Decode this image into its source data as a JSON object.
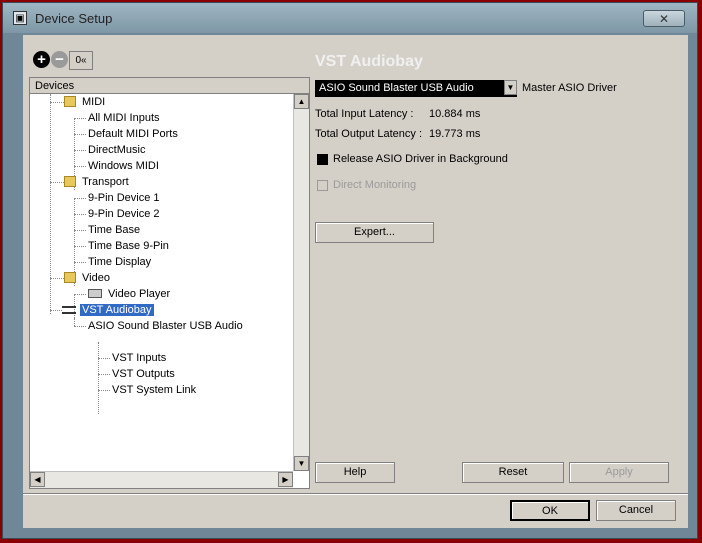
{
  "window": {
    "title": "Device Setup",
    "close_glyph": "✕"
  },
  "toolbar": {
    "reset_label": "0«",
    "add_glyph": "+",
    "remove_glyph": "−"
  },
  "devices_header": "Devices",
  "tree": {
    "midi": "MIDI",
    "midi_items": [
      "All MIDI Inputs",
      "Default MIDI Ports",
      "DirectMusic",
      "Windows MIDI"
    ],
    "transport": "Transport",
    "transport_items": [
      "9-Pin Device 1",
      "9-Pin Device 2",
      "Time Base",
      "Time Base 9-Pin",
      "Time Display"
    ],
    "video": "Video",
    "video_items": [
      "Video Player"
    ],
    "vst_audiobay": "VST Audiobay",
    "asio_driver": "ASIO Sound Blaster USB Audio",
    "asio_items": [
      "VST Inputs",
      "VST Outputs",
      "VST System Link"
    ]
  },
  "panel": {
    "title": "VST Audiobay",
    "driver_value": "ASIO Sound Blaster USB Audio",
    "driver_label": "Master ASIO Driver",
    "input_latency_label": "Total Input Latency :",
    "input_latency_value": "10.884 ms",
    "output_latency_label": "Total Output Latency :",
    "output_latency_value": "19.773 ms",
    "release_label": "Release ASIO Driver in Background",
    "release_checked": true,
    "direct_monitoring_label": "Direct Monitoring",
    "direct_monitoring_enabled": false,
    "expert_button": "Expert..."
  },
  "buttons": {
    "help": "Help",
    "reset": "Reset",
    "apply": "Apply",
    "ok": "OK",
    "cancel": "Cancel"
  },
  "icons": [
    "add-icon",
    "remove-icon",
    "folder-icon",
    "video-icon",
    "audiobay-icon",
    "scroll-up-icon",
    "scroll-down-icon",
    "scroll-left-icon",
    "scroll-right-icon",
    "dropdown-arrow-icon",
    "close-icon"
  ],
  "colors": {
    "selection": "#316ac5",
    "dialog_bg": "#d4d0c8",
    "panel_title": "#f0f0f0"
  }
}
